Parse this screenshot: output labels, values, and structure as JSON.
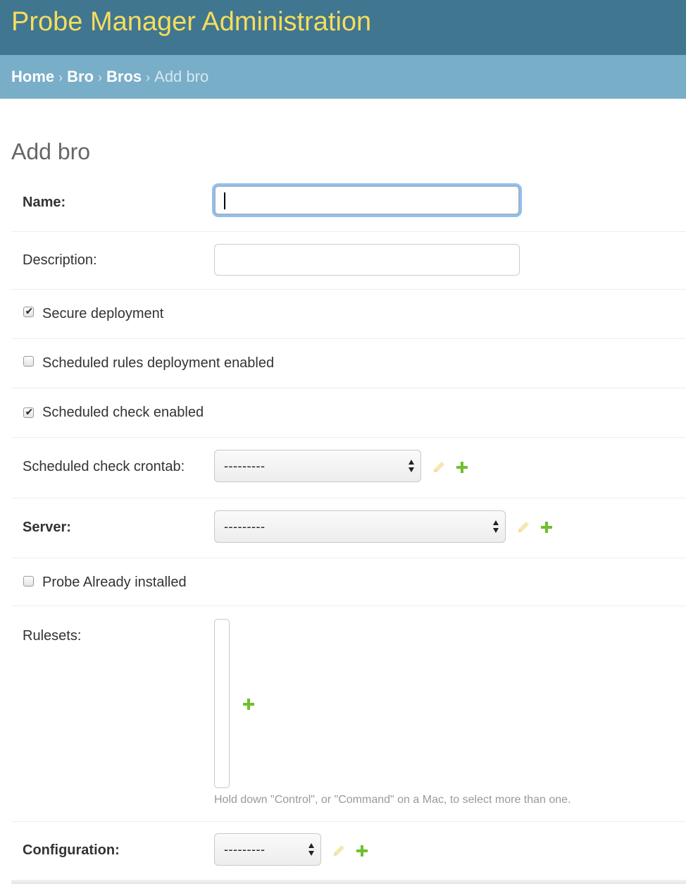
{
  "site": {
    "title": "Probe Manager Administration"
  },
  "breadcrumbs": {
    "home": "Home",
    "app": "Bro",
    "model": "Bros",
    "current": "Add bro",
    "separator": "›"
  },
  "page": {
    "title": "Add bro"
  },
  "form": {
    "name": {
      "label": "Name:",
      "value": "",
      "focused": true
    },
    "description": {
      "label": "Description:",
      "value": ""
    },
    "secure_deployment": {
      "label": "Secure deployment",
      "checked": true
    },
    "scheduled_rules_deployment_enabled": {
      "label": "Scheduled rules deployment enabled",
      "checked": false
    },
    "scheduled_check_enabled": {
      "label": "Scheduled check enabled",
      "checked": true
    },
    "scheduled_check_crontab": {
      "label": "Scheduled check crontab:",
      "value": "---------"
    },
    "server": {
      "label": "Server:",
      "value": "---------"
    },
    "probe_already_installed": {
      "label": "Probe Already installed",
      "checked": false
    },
    "rulesets": {
      "label": "Rulesets:",
      "help": "Hold down \"Control\", or \"Command\" on a Mac, to select more than one."
    },
    "configuration": {
      "label": "Configuration:",
      "value": "---------"
    }
  },
  "icons": {
    "checkmark": "✔",
    "edit": "pencil-icon",
    "add": "plus-icon"
  },
  "colors": {
    "header_bg": "#417690",
    "site_title": "#f5dd5d",
    "breadcrumb_bg": "#79aec8",
    "add_icon": "#70bf2b",
    "edit_icon_disabled": "#f3e3a8"
  }
}
